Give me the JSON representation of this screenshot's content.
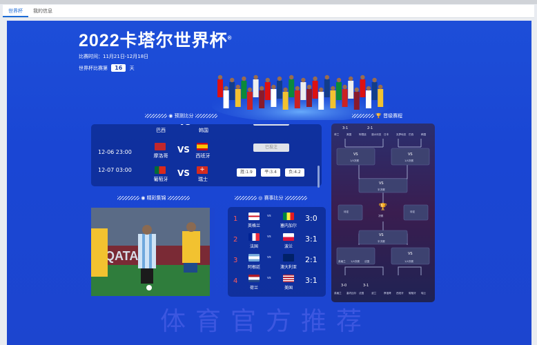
{
  "tabs": [
    "世界杯",
    "我的信息"
  ],
  "header": {
    "title": "2022卡塔尔世界杯",
    "title_mark": "®",
    "dates_label": "比赛时间：11月21日-12月18日",
    "day_prefix": "世界杯比赛第",
    "day_number": "16",
    "day_suffix": "天"
  },
  "sections": {
    "predict": "预测比分",
    "bracket": "晋级赛程",
    "highlights": "精彩集锦",
    "results": "赛事比分"
  },
  "predictions": [
    {
      "time": "",
      "home": "巴西",
      "away": "韩国",
      "status": ""
    },
    {
      "time": "12-06 23:00",
      "home": "摩洛哥",
      "away": "西班牙",
      "status": "已投注"
    },
    {
      "time": "12-07 03:00",
      "home": "葡萄牙",
      "away": "瑞士",
      "odds": [
        "胜:1.9",
        "平:3.4",
        "负:4.2"
      ]
    }
  ],
  "vs_label": "VS",
  "results": [
    {
      "rank": "1",
      "home": "英格兰",
      "away": "塞内加尔",
      "score": "3:0"
    },
    {
      "rank": "2",
      "home": "法国",
      "away": "波兰",
      "score": "3:1"
    },
    {
      "rank": "3",
      "home": "阿根廷",
      "away": "澳大利亚",
      "score": "2:1"
    },
    {
      "rank": "4",
      "home": "荷兰",
      "away": "美国",
      "score": "3:1"
    }
  ],
  "bracket": {
    "top_scores": [
      "3-1",
      "2-1"
    ],
    "top_teams": [
      "荷兰",
      "美国",
      "阿根廷",
      "澳大利亚",
      "日本",
      "克罗地亚",
      "巴西",
      "韩国"
    ],
    "qf_labels": [
      "1/4决赛",
      "待定",
      "1/4决赛",
      "待定"
    ],
    "sf_label": "半决赛",
    "final_label": "决赛",
    "tbd": "待定",
    "bottom_left": [
      "英格兰",
      "1/4决赛",
      "法国"
    ],
    "bottom_scores": [
      "3-0",
      "3-1"
    ],
    "bottom_teams": [
      "英格兰",
      "塞内加尔",
      "法国",
      "波兰",
      "摩洛哥",
      "西班牙",
      "葡萄牙",
      "瑞士"
    ]
  },
  "watermark": "体育官方推荐",
  "colors": {
    "accent": "#1b6ad6",
    "bg_blue": "#1d4ed8",
    "rank_red": "#ff5a5a"
  }
}
